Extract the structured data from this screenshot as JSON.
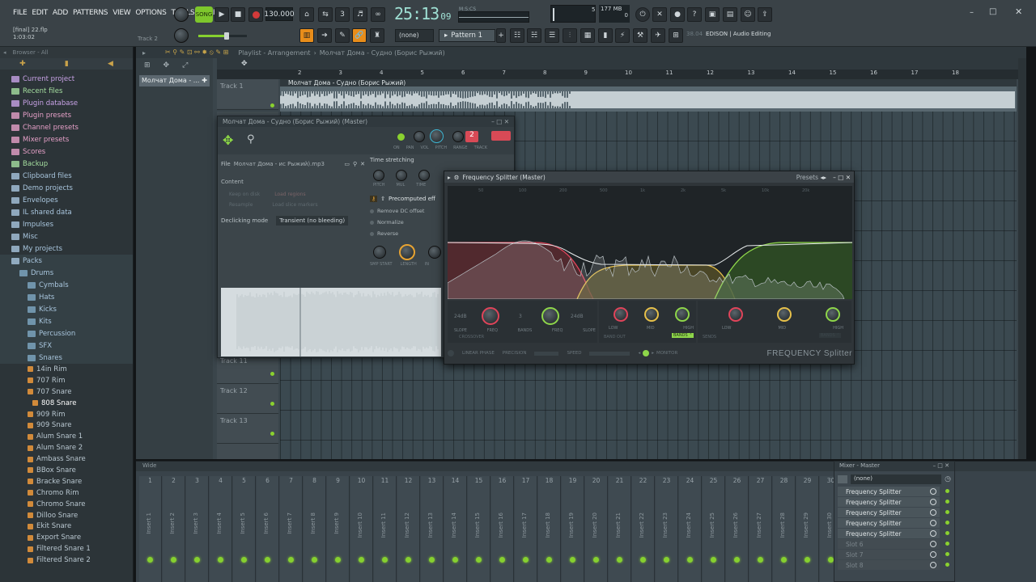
{
  "menu": [
    "FILE",
    "EDIT",
    "ADD",
    "PATTERNS",
    "VIEW",
    "OPTIONS",
    "TOOLS",
    "HELP"
  ],
  "transport": {
    "mode": "SONG",
    "tempo": "130.000",
    "time": "25:13",
    "time_sub": "09",
    "time_unit": "M:S:CS"
  },
  "cpu": {
    "cpu_label": "5",
    "memory": "177 MB",
    "polyphony": "0"
  },
  "project": {
    "file": "[final] 22.flp",
    "time": "1:03:02",
    "track": "Track 2"
  },
  "pattern": {
    "none_label": "(none)",
    "pattern_label": "Pattern 1"
  },
  "hint": {
    "version": "38.04",
    "text": "EDISON | Audio Editing"
  },
  "browser": {
    "title": "Browser - All",
    "items": [
      {
        "label": "Current project",
        "indent": 0,
        "color": "#c8a2e6",
        "active": false
      },
      {
        "label": "Recent files",
        "indent": 0,
        "color": "#a6dfa0",
        "active": false
      },
      {
        "label": "Plugin database",
        "indent": 0,
        "color": "#c8a2e6",
        "active": false
      },
      {
        "label": "Plugin presets",
        "indent": 0,
        "color": "#e6a0c8",
        "active": false
      },
      {
        "label": "Channel presets",
        "indent": 0,
        "color": "#e6a0c8",
        "active": false
      },
      {
        "label": "Mixer presets",
        "indent": 0,
        "color": "#e6a0c8",
        "active": false
      },
      {
        "label": "Scores",
        "indent": 0,
        "color": "#e6a0c8",
        "active": false
      },
      {
        "label": "Backup",
        "indent": 0,
        "color": "#a6dfa0",
        "active": false
      },
      {
        "label": "Clipboard files",
        "indent": 0,
        "color": "#a9c6de",
        "active": false
      },
      {
        "label": "Demo projects",
        "indent": 0,
        "color": "#a9c6de",
        "active": false
      },
      {
        "label": "Envelopes",
        "indent": 0,
        "color": "#a9c6de",
        "active": false
      },
      {
        "label": "IL shared data",
        "indent": 0,
        "color": "#a9c6de",
        "active": false
      },
      {
        "label": "Impulses",
        "indent": 0,
        "color": "#a9c6de",
        "active": false
      },
      {
        "label": "Misc",
        "indent": 0,
        "color": "#a9c6de",
        "active": false
      },
      {
        "label": "My projects",
        "indent": 0,
        "color": "#a9c6de",
        "active": false
      },
      {
        "label": "Packs",
        "indent": 0,
        "color": "#a9c6de",
        "active": true
      },
      {
        "label": "Drums",
        "indent": 1,
        "color": "#a9c6de",
        "active": true
      },
      {
        "label": "Cymbals",
        "indent": 2,
        "color": "#a9c6de",
        "active": true
      },
      {
        "label": "Hats",
        "indent": 2,
        "color": "#a9c6de",
        "active": true
      },
      {
        "label": "Kicks",
        "indent": 2,
        "color": "#a9c6de",
        "active": true
      },
      {
        "label": "Kits",
        "indent": 2,
        "color": "#a9c6de",
        "active": true
      },
      {
        "label": "Percussion",
        "indent": 2,
        "color": "#a9c6de",
        "active": true
      },
      {
        "label": "SFX",
        "indent": 2,
        "color": "#a9c6de",
        "active": true
      },
      {
        "label": "Snares",
        "indent": 2,
        "color": "#a9c6de",
        "active": true
      }
    ],
    "files": [
      "14in Rim",
      "707 Rim",
      "707 Snare",
      "808 Snare",
      "909 Rim",
      "909 Snare",
      "Alum Snare 1",
      "Alum Snare 2",
      "Ambass Snare",
      "BBox Snare",
      "Bracke Snare",
      "Chromo Rim",
      "Chromo Snare",
      "Dilloo Snare",
      "Ekit Snare",
      "Export Snare",
      "Filtered Snare 1",
      "Filtered Snare 2"
    ],
    "selected_file": "808 Snare"
  },
  "playlist": {
    "title": "Playlist - Arrangement",
    "crumb": "Молчат Дома - Судно (Борис Рыжий)",
    "clip_label": "Молчат Дома - ...",
    "audio_clip": "Молчат Дома - Судно (Борис Рыжий)",
    "track1": "Track 1",
    "bars": [
      "2",
      "3",
      "4",
      "5",
      "6",
      "7",
      "8",
      "9",
      "10",
      "11",
      "12",
      "13",
      "14",
      "15",
      "16",
      "17",
      "18"
    ],
    "tracks_lower": [
      "Track 11",
      "Track 12",
      "Track 13"
    ]
  },
  "sampler": {
    "title": "Молчат Дома - Судно (Борис Рыжий) (Master)",
    "knob_labels": [
      "ON",
      "PAN",
      "VOL",
      "PITCH",
      "RANGE",
      "TRACK"
    ],
    "track_num": "2",
    "file_label": "File",
    "file_name": "Молчат Дома - ис Рыжий).mp3",
    "content_label": "Content",
    "opt_keep": "Keep on disk",
    "opt_resample": "Resample",
    "opt_load_regions": "Load regions",
    "opt_load_markers": "Load slice markers",
    "declick_label": "Declicking mode",
    "declick_value": "Transient (no bleeding)",
    "timestretch_label": "Time stretching",
    "ts_knobs": [
      "PITCH",
      "MUL",
      "TIME"
    ],
    "precomputed_label": "Precomputed eff",
    "fx_options": [
      "Remove DC offset",
      "Normalize",
      "Reverse"
    ],
    "bottom_knobs": [
      "SMP START",
      "LENGTH",
      "IN"
    ]
  },
  "fsplitter": {
    "title": "Frequency Splitter (Master)",
    "presets": "Presets",
    "freq_ticks": [
      "50",
      "100",
      "200",
      "500",
      "1k",
      "2k",
      "5k",
      "10k",
      "20k"
    ],
    "slope_left": "24dB",
    "slope_right": "24dB",
    "bands_value": "3",
    "labels": [
      "SLOPE",
      "FREQ",
      "BANDS",
      "FREQ",
      "SLOPE"
    ],
    "crossover": "CROSSOVER",
    "band_out": "BAND OUT",
    "sends": [
      "LOW",
      "MID",
      "HIGH"
    ],
    "sends_label": "SENDS",
    "linear_phase": "LINEAR PHASE",
    "precision": "PRECISION",
    "speed": "SPEED",
    "monitor": "MONITOR",
    "brand": "FREQUENCY Splitter",
    "colors": {
      "low": "#e0445a",
      "mid": "#e6c04a",
      "high": "#8ed64a"
    }
  },
  "mixer": {
    "title": "Wide",
    "numbers": [
      "1",
      "2",
      "3",
      "4",
      "5",
      "6",
      "7",
      "8",
      "9",
      "10",
      "11",
      "12",
      "13",
      "14",
      "15",
      "16",
      "17",
      "18",
      "19",
      "20",
      "21",
      "22",
      "23",
      "24",
      "25",
      "26",
      "27",
      "28",
      "29",
      "30"
    ],
    "insert_prefix": "Insert",
    "master_title": "Mixer - Master",
    "slot_none": "(none)",
    "slots": [
      "Frequency Splitter",
      "Frequency Splitter",
      "Frequency Splitter",
      "Frequency Splitter",
      "Frequency Splitter"
    ],
    "dim_slots": [
      "Slot 6",
      "Slot 7",
      "Slot 8"
    ]
  }
}
